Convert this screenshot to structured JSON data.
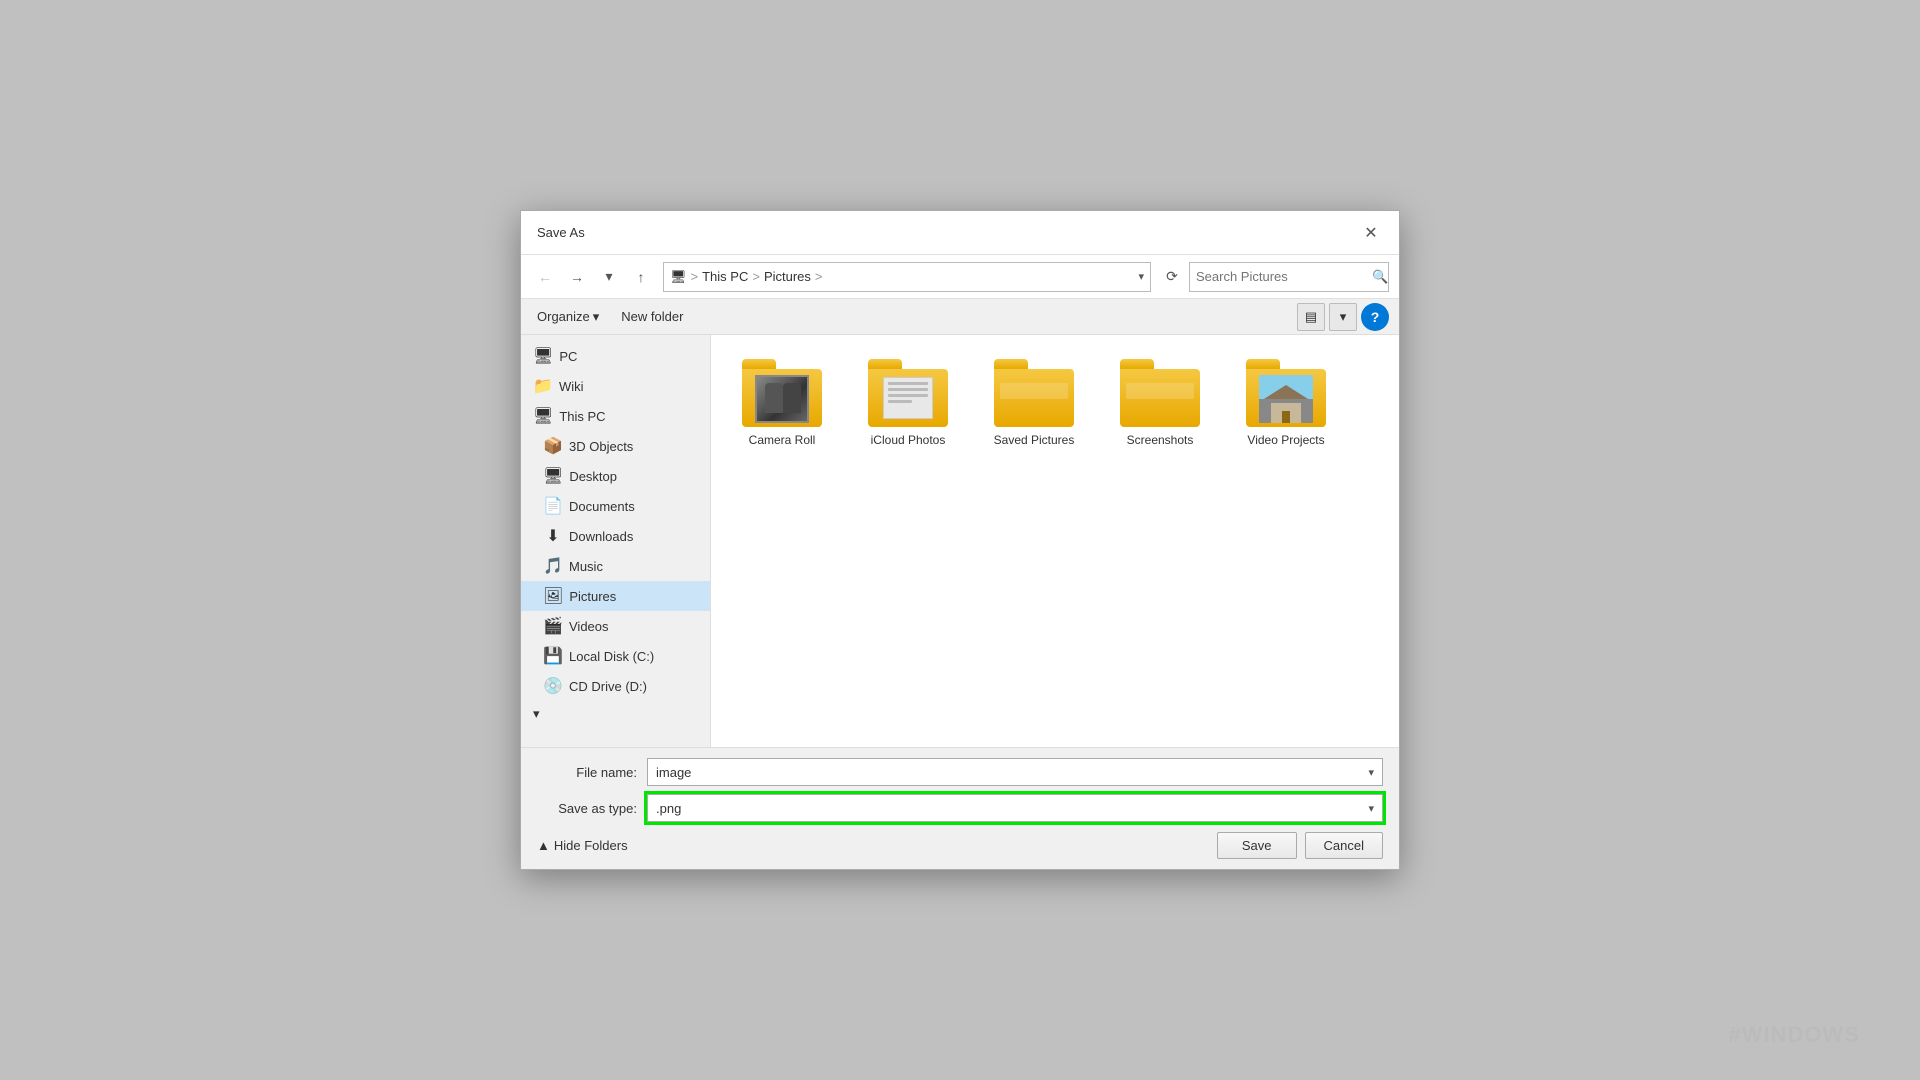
{
  "dialog": {
    "title": "Save As",
    "close_label": "✕"
  },
  "toolbar": {
    "back_label": "←",
    "forward_label": "→",
    "dropdown_label": "▾",
    "up_label": "↑",
    "address": {
      "pc_icon": "🖥",
      "this_pc": "This PC",
      "sep1": ">",
      "pictures": "Pictures",
      "sep2": ">"
    },
    "address_dropdown": "▾",
    "refresh_label": "⟳",
    "search_placeholder": "Search Pictures",
    "search_icon": "🔍"
  },
  "toolbar2": {
    "organize_label": "Organize",
    "organize_arrow": "▾",
    "new_folder_label": "New folder",
    "view_icon": "▤",
    "view_dropdown": "▾",
    "help_label": "?"
  },
  "sidebar": {
    "items": [
      {
        "id": "pc",
        "icon": "🖥",
        "label": "PC",
        "indent": false
      },
      {
        "id": "wiki",
        "icon": "📁",
        "label": "Wiki",
        "indent": false
      },
      {
        "id": "this-pc",
        "icon": "🖥",
        "label": "This PC",
        "indent": false
      },
      {
        "id": "3d-objects",
        "icon": "📦",
        "label": "3D Objects",
        "indent": true
      },
      {
        "id": "desktop",
        "icon": "🖥",
        "label": "Desktop",
        "indent": true
      },
      {
        "id": "documents",
        "icon": "📄",
        "label": "Documents",
        "indent": true
      },
      {
        "id": "downloads",
        "icon": "⬇",
        "label": "Downloads",
        "indent": true
      },
      {
        "id": "music",
        "icon": "🎵",
        "label": "Music",
        "indent": true
      },
      {
        "id": "pictures",
        "icon": "🖼",
        "label": "Pictures",
        "indent": true,
        "active": true
      },
      {
        "id": "videos",
        "icon": "🎬",
        "label": "Videos",
        "indent": true
      },
      {
        "id": "local-disk-c",
        "icon": "💾",
        "label": "Local Disk (C:)",
        "indent": true
      },
      {
        "id": "cd-drive-d",
        "icon": "💿",
        "label": "CD Drive (D:)",
        "indent": true
      }
    ]
  },
  "files": [
    {
      "id": "camera-roll",
      "label": "Camera Roll",
      "type": "camera-roll"
    },
    {
      "id": "icloud-photos",
      "label": "iCloud Photos",
      "type": "icloud"
    },
    {
      "id": "saved-pictures",
      "label": "Saved Pictures",
      "type": "plain"
    },
    {
      "id": "screenshots",
      "label": "Screenshots",
      "type": "plain"
    },
    {
      "id": "video-projects",
      "label": "Video Projects",
      "type": "video"
    }
  ],
  "form": {
    "file_name_label": "File name:",
    "file_name_value": "image",
    "save_as_type_label": "Save as type:",
    "save_as_type_value": ".png",
    "file_name_dropdown": "▾",
    "save_as_type_dropdown": "▾"
  },
  "footer": {
    "hide_folders_icon": "▲",
    "hide_folders_label": "Hide Folders",
    "save_label": "Save",
    "cancel_label": "Cancel"
  },
  "watermark": "#WINDOWS"
}
